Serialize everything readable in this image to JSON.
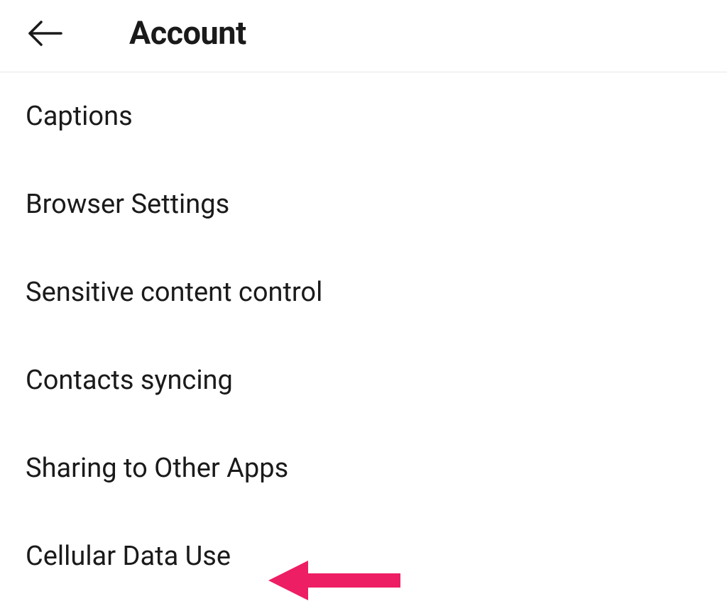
{
  "header": {
    "title": "Account"
  },
  "menu": {
    "items": [
      {
        "label": "Captions"
      },
      {
        "label": "Browser Settings"
      },
      {
        "label": "Sensitive content control"
      },
      {
        "label": "Contacts syncing"
      },
      {
        "label": "Sharing to Other Apps"
      },
      {
        "label": "Cellular Data Use"
      }
    ]
  },
  "annotation": {
    "arrow_color": "#ed1e64"
  }
}
